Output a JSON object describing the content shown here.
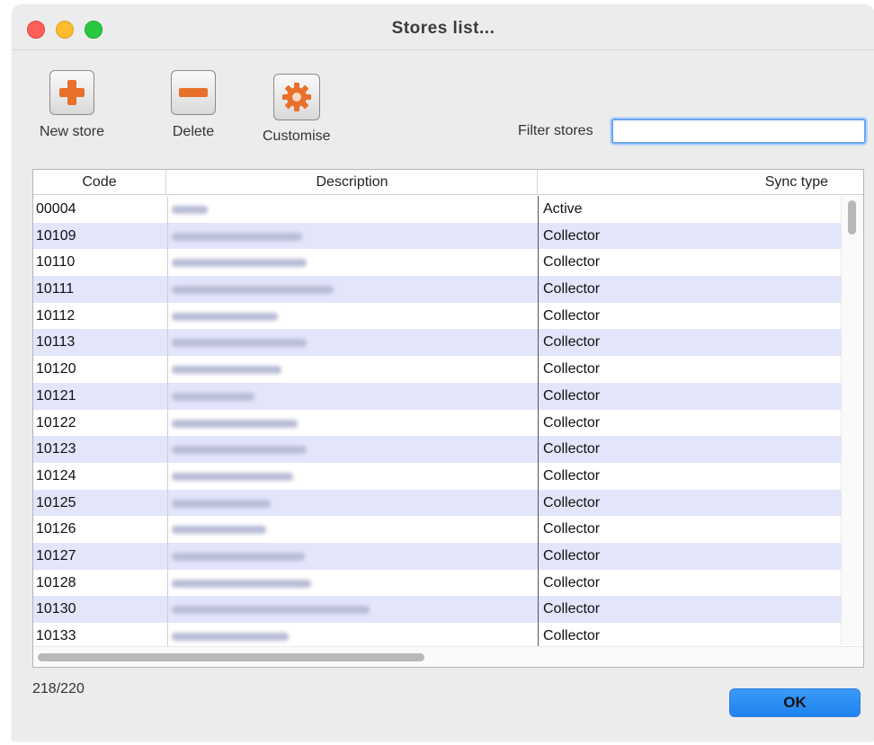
{
  "window": {
    "title": "Stores list..."
  },
  "toolbar": {
    "new_store": "New store",
    "delete": "Delete",
    "customise": "Customise"
  },
  "filter": {
    "label": "Filter stores",
    "value": ""
  },
  "table": {
    "headers": {
      "code": "Code",
      "description": "Description",
      "sync_type": "Sync type"
    },
    "rows": [
      {
        "code": "00004",
        "sync": "Active",
        "desc_w": 40
      },
      {
        "code": "10109",
        "sync": "Collector",
        "desc_w": 145
      },
      {
        "code": "10110",
        "sync": "Collector",
        "desc_w": 150
      },
      {
        "code": "10111",
        "sync": "Collector",
        "desc_w": 180
      },
      {
        "code": "10112",
        "sync": "Collector",
        "desc_w": 118
      },
      {
        "code": "10113",
        "sync": "Collector",
        "desc_w": 150
      },
      {
        "code": "10120",
        "sync": "Collector",
        "desc_w": 122
      },
      {
        "code": "10121",
        "sync": "Collector",
        "desc_w": 92
      },
      {
        "code": "10122",
        "sync": "Collector",
        "desc_w": 140
      },
      {
        "code": "10123",
        "sync": "Collector",
        "desc_w": 150
      },
      {
        "code": "10124",
        "sync": "Collector",
        "desc_w": 135
      },
      {
        "code": "10125",
        "sync": "Collector",
        "desc_w": 110
      },
      {
        "code": "10126",
        "sync": "Collector",
        "desc_w": 105
      },
      {
        "code": "10127",
        "sync": "Collector",
        "desc_w": 148
      },
      {
        "code": "10128",
        "sync": "Collector",
        "desc_w": 155
      },
      {
        "code": "10130",
        "sync": "Collector",
        "desc_w": 220
      },
      {
        "code": "10133",
        "sync": "Collector",
        "desc_w": 130
      }
    ]
  },
  "status": {
    "count": "218/220"
  },
  "buttons": {
    "ok": "OK"
  },
  "colors": {
    "accent": "#1e83f0",
    "row_alt": "#e3e5fb",
    "icon_orange": "#e8702a"
  }
}
